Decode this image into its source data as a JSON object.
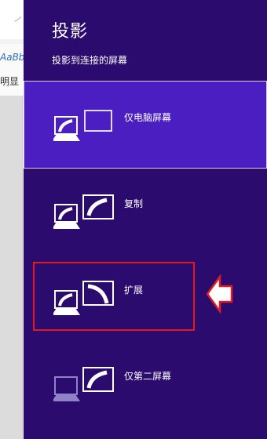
{
  "background_app": {
    "style_sample": "AaBbC",
    "style_name": "明显"
  },
  "panel": {
    "title": "投影",
    "subtitle": "投影到连接的屏幕",
    "options": [
      {
        "label": "仅电脑屏幕",
        "icon": "pc-screen-only-icon",
        "selected": true
      },
      {
        "label": "复制",
        "icon": "duplicate-icon",
        "selected": false
      },
      {
        "label": "扩展",
        "icon": "extend-icon",
        "selected": false
      },
      {
        "label": "仅第二屏幕",
        "icon": "second-screen-only-icon",
        "selected": false
      }
    ]
  },
  "annotation": {
    "highlight_color": "#e11b22",
    "arrow_icon": "left-arrow-outline-icon"
  },
  "colors": {
    "panel_bg": "#2b0b6e",
    "selected_bg": "#4a1ec0",
    "text": "#ffffff"
  }
}
